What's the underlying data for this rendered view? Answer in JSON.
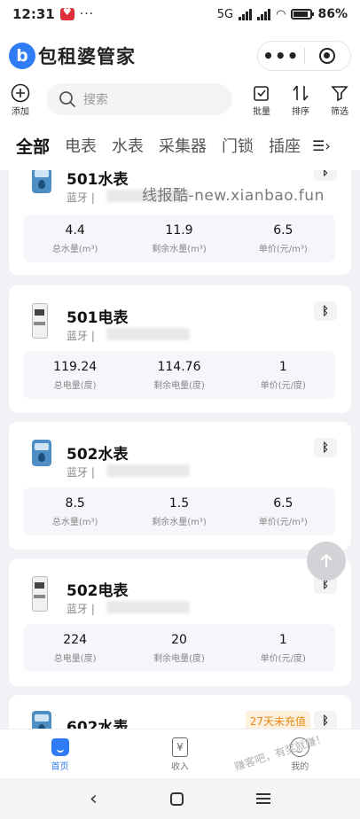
{
  "status_bar": {
    "time": "12:31",
    "dots": "···",
    "network": "5G",
    "battery": "86%"
  },
  "header": {
    "logo_letter": "b",
    "title": "包租婆管家",
    "more": "•••"
  },
  "toolbar": {
    "add_label": "添加",
    "search_placeholder": "搜索",
    "batch_label": "批量",
    "sort_label": "排序",
    "filter_label": "筛选"
  },
  "tabs": [
    "全部",
    "电表",
    "水表",
    "采集器",
    "门锁",
    "插座"
  ],
  "watermark": "线报酷-new.xianbao.fun",
  "devices": [
    {
      "name": "501水表",
      "conn": "蓝牙 |",
      "type": "water",
      "stats": [
        {
          "value": "4.4",
          "label": "总水量(m³)"
        },
        {
          "value": "11.9",
          "label": "剩余水量(m³)"
        },
        {
          "value": "6.5",
          "label": "单价(元/m³)"
        }
      ]
    },
    {
      "name": "501电表",
      "conn": "蓝牙 |",
      "type": "elec",
      "stats": [
        {
          "value": "119.24",
          "label": "总电量(度)"
        },
        {
          "value": "114.76",
          "label": "剩余电量(度)"
        },
        {
          "value": "1",
          "label": "单价(元/度)"
        }
      ]
    },
    {
      "name": "502水表",
      "conn": "蓝牙 |",
      "type": "water",
      "stats": [
        {
          "value": "8.5",
          "label": "总水量(m³)"
        },
        {
          "value": "1.5",
          "label": "剩余水量(m³)"
        },
        {
          "value": "6.5",
          "label": "单价(元/m³)"
        }
      ]
    },
    {
      "name": "502电表",
      "conn": "蓝牙 |",
      "type": "elec",
      "stats": [
        {
          "value": "224",
          "label": "总电量(度)"
        },
        {
          "value": "20",
          "label": "剩余电量(度)"
        },
        {
          "value": "1",
          "label": "单价(元/度)"
        }
      ]
    },
    {
      "name": "602水表",
      "type": "water",
      "tag": "27天未充值"
    }
  ],
  "bottom_nav": {
    "home": "首页",
    "income": "收入",
    "me": "我的"
  },
  "corner_watermark": "赚客吧，有奖就赚！",
  "colors": {
    "accent": "#2f7cf6",
    "tag_text": "#e38a17",
    "tag_bg": "#fdf0dd"
  }
}
